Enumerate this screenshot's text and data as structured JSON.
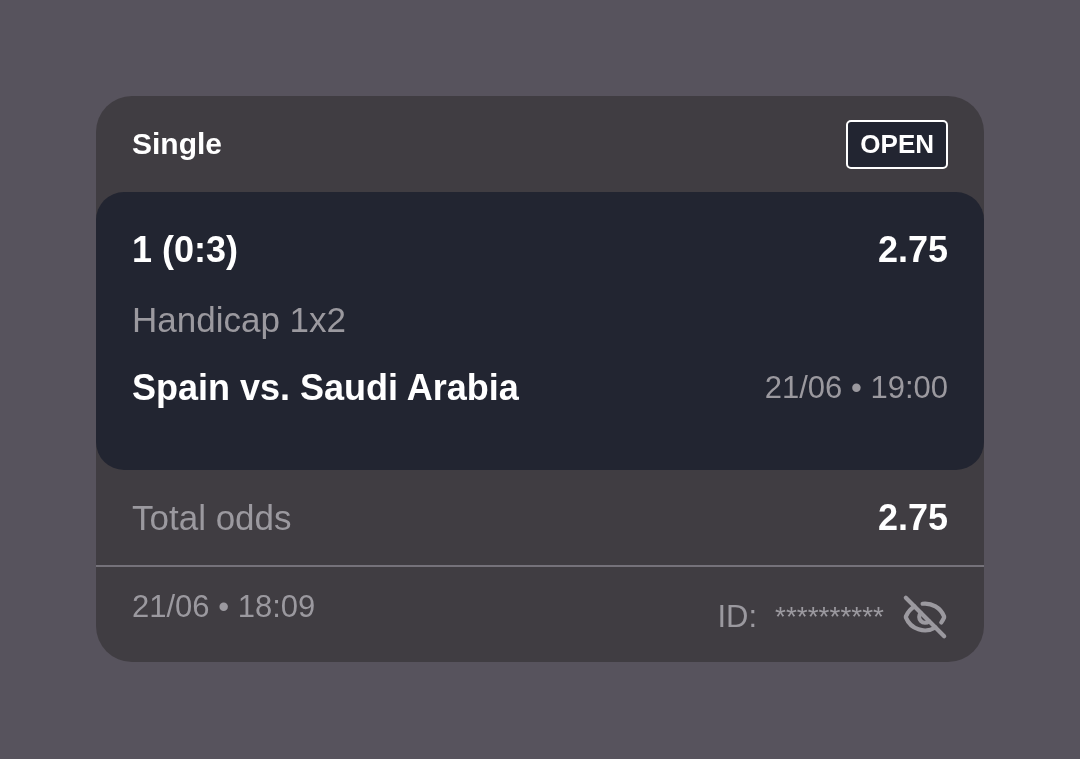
{
  "bet": {
    "type": "Single",
    "status": "OPEN"
  },
  "selection": {
    "pick": "1 (0:3)",
    "odds": "2.75",
    "market": "Handicap 1x2",
    "event": "Spain vs. Saudi Arabia",
    "event_time": "21/06 • 19:00"
  },
  "total": {
    "label": "Total odds",
    "value": "2.75"
  },
  "footer": {
    "placed_time": "21/06 • 18:09",
    "id_label": "ID:",
    "id_value": "**********",
    "id_hidden": true
  }
}
